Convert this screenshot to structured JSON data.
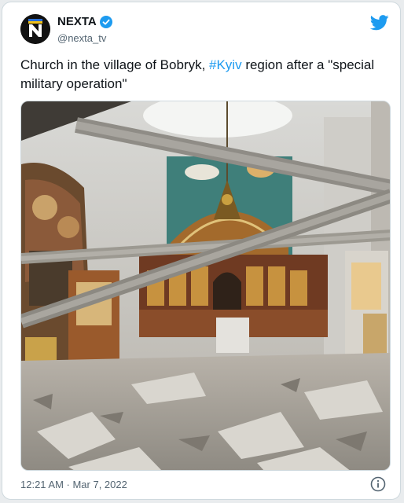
{
  "tweet": {
    "author_name": "NEXTA",
    "author_handle": "@nexta_tv",
    "text_before": "Church in the village of Bobryk, ",
    "hashtag": "#Kyiv",
    "text_after": " region after a \"special military operation\"",
    "timestamp": "12:21 AM · Mar 7, 2022"
  },
  "icons": {
    "avatar": "nexta-logo",
    "verified": "verified-badge-icon",
    "brand": "twitter-bird-icon",
    "info": "info-icon"
  },
  "colors": {
    "accent": "#1d9bf0",
    "text": "#0f1419",
    "secondary": "#536471"
  }
}
